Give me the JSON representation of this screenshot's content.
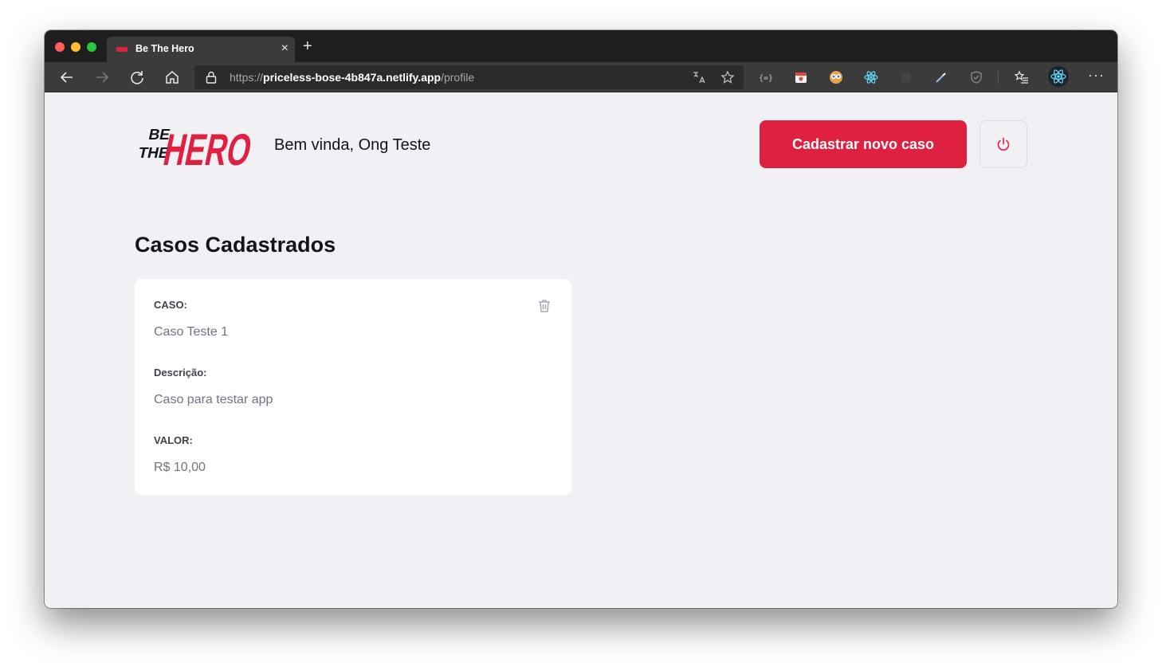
{
  "browser": {
    "tab_title": "Be The Hero",
    "tab_close": "×",
    "new_tab": "+",
    "url_scheme": "https://",
    "url_host": "priceless-bose-4b847a.netlify.app",
    "url_path": "/profile",
    "more_menu": "···"
  },
  "header": {
    "logo_line1": "BE",
    "logo_line2": "THE",
    "logo_word": "HERO",
    "welcome": "Bem vinda, Ong Teste",
    "new_case_button": "Cadastrar novo caso"
  },
  "main": {
    "title": "Casos Cadastrados",
    "cases": [
      {
        "case_label": "CASO:",
        "case_value": "Caso Teste 1",
        "description_label": "Descrição:",
        "description_value": "Caso para testar app",
        "value_label": "VALOR:",
        "value_value": "R$ 10,00"
      }
    ]
  },
  "colors": {
    "accent": "#e02041",
    "background": "#f0f0f5",
    "text_dark": "#13131a",
    "text_muted": "#737380"
  }
}
